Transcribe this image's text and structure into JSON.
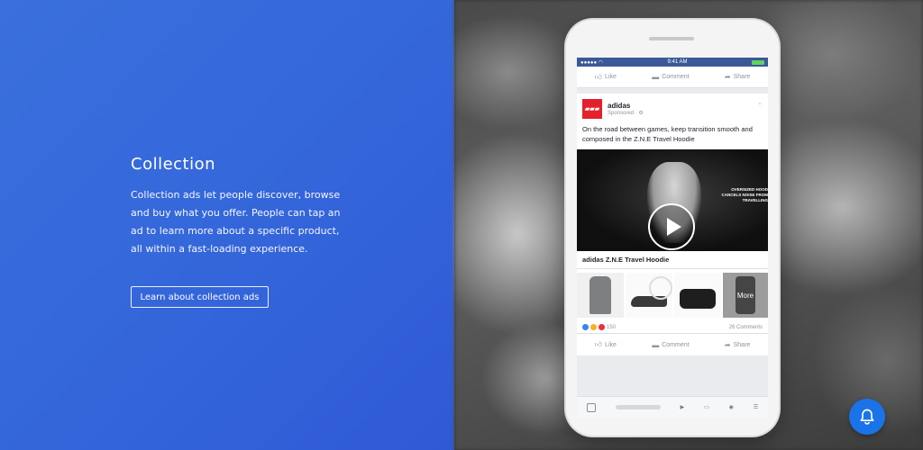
{
  "section": {
    "title": "Collection",
    "description": "Collection ads let people discover, browse and buy what you offer. People can tap an ad to learn more about a specific product, all within a fast-loading experience.",
    "cta_label": "Learn about collection ads"
  },
  "phone": {
    "status_bar": {
      "time": "9:41 AM"
    },
    "top_actions": {
      "like": "Like",
      "comment": "Comment",
      "share": "Share"
    },
    "post": {
      "author": "adidas",
      "sponsored": "Sponsored · ⚙",
      "text": "On the road between games, keep transition smooth and composed in the Z.N.E Travel Hoodie",
      "video_caption": "OVERSIZED HOOD CANCELS NOISE FROM TRAVELLING",
      "product_title": "adidas Z.N.E Travel Hoodie",
      "more_label": "More",
      "reaction_count": "150",
      "comments_count": "26 Comments"
    },
    "bottom_actions": {
      "like": "Like",
      "comment": "Comment",
      "share": "Share"
    }
  },
  "colors": {
    "left_bg": "#3568db",
    "facebook_blue": "#3b5998",
    "adidas_red": "#e3202b",
    "bell_bg": "#1a73e8"
  },
  "icons": [
    "like-icon",
    "comment-icon",
    "share-icon",
    "play-icon",
    "bell-icon"
  ]
}
